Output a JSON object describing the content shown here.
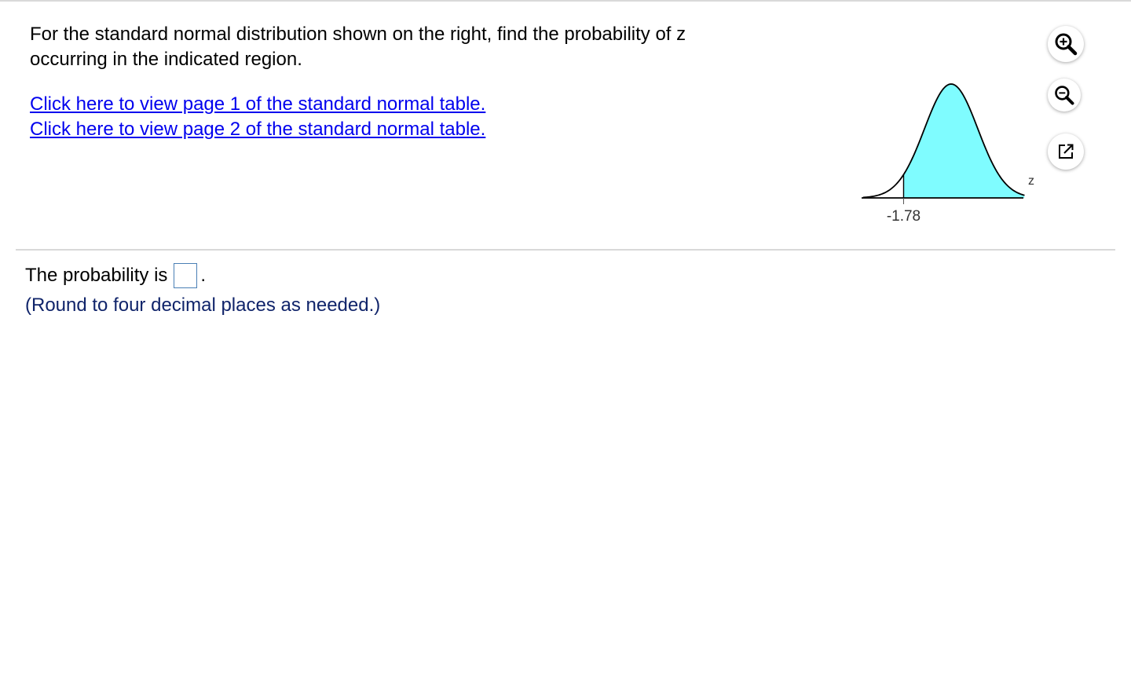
{
  "question": {
    "text": "For the standard normal distribution shown on the right, find the probability of z occurring in the indicated region."
  },
  "links": [
    {
      "label": "Click here to view page 1 of the standard normal table."
    },
    {
      "label": "Click here to view page 2 of the standard normal table."
    }
  ],
  "graph": {
    "z_value_label": "-1.78",
    "axis_label": "z",
    "shaded_region": "right of -1.78",
    "fill_color": "#7ffcff"
  },
  "tools": {
    "zoom_in_icon": "zoom-in-icon",
    "zoom_out_icon": "zoom-out-icon",
    "popout_icon": "popout-icon"
  },
  "answer": {
    "prefix": "The probability is",
    "suffix": ".",
    "value": "",
    "hint": "(Round to four decimal places as needed.)"
  }
}
